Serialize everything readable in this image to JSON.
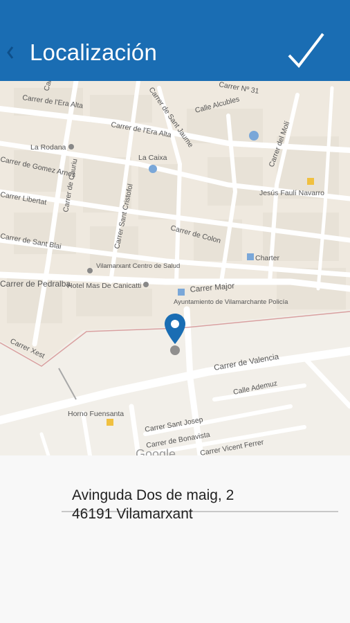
{
  "header": {
    "title": "Localización",
    "back_icon": "chevron-left-icon",
    "confirm_icon": "checkmark-icon",
    "background_color": "#1a6db3"
  },
  "map": {
    "labels": [
      "Calle",
      "Carrer Nº 31",
      "Carrer de l'Era Alta",
      "Carrer de Sant Jaume",
      "Calle Alcubles",
      "Carrer de l'Era Alta",
      "Carrer del Molí",
      "La Rodana",
      "La Caixa",
      "Carrer de Gomez Arnes",
      "Carrer de Cauriu",
      "Carrer Sant Cristofol",
      "Jesús Faulí Navarro",
      "Carrer Libertat",
      "Carrer de Colon",
      "Carrer de Sant Blai",
      "Charter",
      "Vilamarxant Centro de Salud",
      "Hotel Mas De Canicatti",
      "Carrer de Pedralba",
      "Carrer Major",
      "Ayuntamiento de Vilamarchante Policía",
      "Carrer Xest",
      "Carrer de Valencia",
      "Calle Ademuz",
      "Horno Fuensanta",
      "Carrer Sant Josep",
      "Carrer de Bonavista",
      "Carrer Vicent Ferrer",
      "Google"
    ],
    "pin_icon": "map-pin-icon"
  },
  "address": {
    "line1": "Avinguda Dos de maig, 2",
    "line2": "46191 Vilamarxant"
  }
}
